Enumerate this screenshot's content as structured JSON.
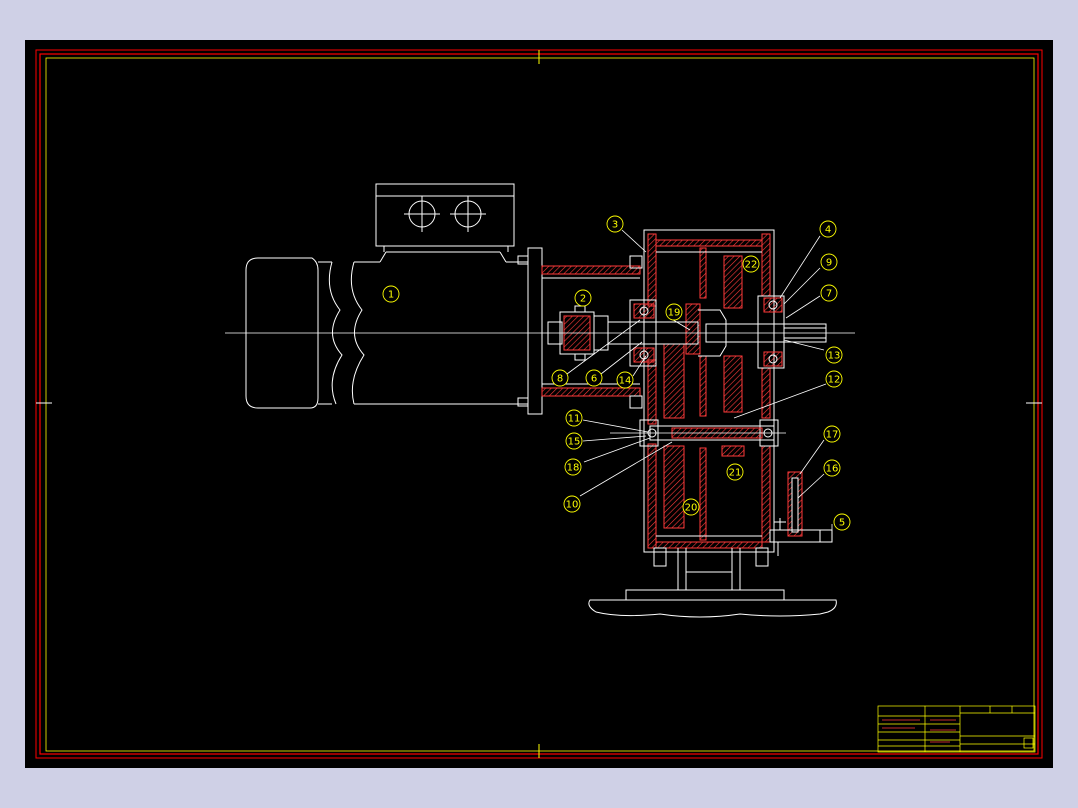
{
  "colors": {
    "background": "#cfd0e6",
    "canvas": "#000000",
    "frame_line": "#ff0000",
    "geometry": "#ffffff",
    "section_hatch": "#ff3a3a",
    "balloon": "#ffff00"
  },
  "part_labels": [
    "1",
    "2",
    "3",
    "4",
    "5",
    "6",
    "7",
    "8",
    "9",
    "10",
    "11",
    "12",
    "13",
    "14",
    "15",
    "16",
    "17",
    "18",
    "19",
    "20",
    "21",
    "22"
  ]
}
